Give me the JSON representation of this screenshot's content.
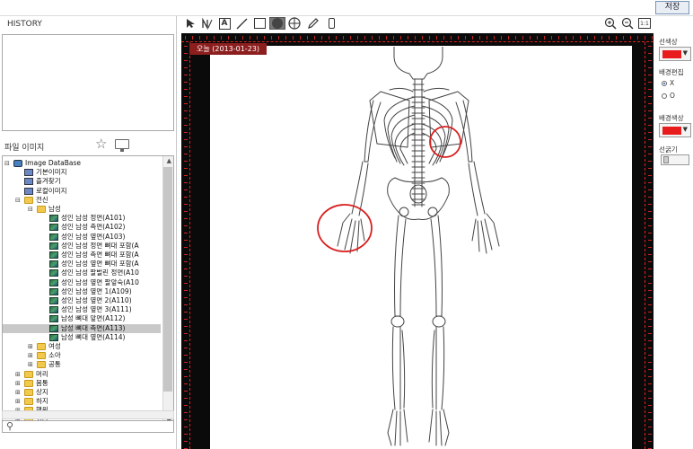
{
  "toolbar": {
    "save_label": "저장",
    "zoom_reset_label": "1:1",
    "tools": [
      "pointer-icon",
      "line-number-icon",
      "text-icon",
      "line-icon",
      "rectangle-icon",
      "ellipse-icon",
      "grid-circle-icon",
      "pen-icon",
      "eraser-icon"
    ],
    "view_tools": [
      "zoom-in-icon",
      "zoom-out-icon",
      "zoom-reset-icon",
      "fit-icon",
      "settings-icon"
    ]
  },
  "left_panel": {
    "history_label": "HISTORY",
    "file_label": "파일 이미지",
    "tree": [
      {
        "level": 0,
        "toggle": "⊟",
        "icon": "db",
        "label": "Image DataBase"
      },
      {
        "level": 1,
        "toggle": "",
        "icon": "util",
        "label": "기본이미지"
      },
      {
        "level": 1,
        "toggle": "",
        "icon": "util",
        "label": "즐겨찾기"
      },
      {
        "level": 1,
        "toggle": "",
        "icon": "util",
        "label": "로컬이미지"
      },
      {
        "level": 1,
        "toggle": "⊟",
        "icon": "folder",
        "label": "전신"
      },
      {
        "level": 2,
        "toggle": "⊟",
        "icon": "folder",
        "label": "남성"
      },
      {
        "level": 3,
        "toggle": "",
        "icon": "img",
        "label": "성인 남성 정면(A101)"
      },
      {
        "level": 3,
        "toggle": "",
        "icon": "img",
        "label": "성인 남성 측면(A102)"
      },
      {
        "level": 3,
        "toggle": "",
        "icon": "img",
        "label": "성인 남성 옆면(A103)"
      },
      {
        "level": 3,
        "toggle": "",
        "icon": "img",
        "label": "성인 남성 정면 뼈대 포함(A"
      },
      {
        "level": 3,
        "toggle": "",
        "icon": "img",
        "label": "성인 남성 측면 뼈대 포함(A"
      },
      {
        "level": 3,
        "toggle": "",
        "icon": "img",
        "label": "성인 남성 옆면 뼈대 포함(A"
      },
      {
        "level": 3,
        "toggle": "",
        "icon": "img",
        "label": "성인 남성 팔벌린 정면(A10"
      },
      {
        "level": 3,
        "toggle": "",
        "icon": "img",
        "label": "성인 남성 옆면 팔앞숙(A10"
      },
      {
        "level": 3,
        "toggle": "",
        "icon": "img",
        "label": "성인 남성 옆면 1(A109)"
      },
      {
        "level": 3,
        "toggle": "",
        "icon": "img",
        "label": "성인 남성 옆면 2(A110)"
      },
      {
        "level": 3,
        "toggle": "",
        "icon": "img",
        "label": "성인 남성 옆면 3(A111)"
      },
      {
        "level": 3,
        "toggle": "",
        "icon": "img",
        "label": "남성 뼈대 앞면(A112)"
      },
      {
        "level": 3,
        "toggle": "",
        "icon": "img",
        "label": "남성 뼈대 측면(A113)",
        "selected": true
      },
      {
        "level": 3,
        "toggle": "",
        "icon": "img",
        "label": "남성 뼈대 옆면(A114)"
      },
      {
        "level": 2,
        "toggle": "⊞",
        "icon": "folder",
        "label": "여성"
      },
      {
        "level": 2,
        "toggle": "⊞",
        "icon": "folder",
        "label": "소아"
      },
      {
        "level": 2,
        "toggle": "⊞",
        "icon": "folder",
        "label": "공통"
      },
      {
        "level": 1,
        "toggle": "⊞",
        "icon": "folder",
        "label": "머리"
      },
      {
        "level": 1,
        "toggle": "⊞",
        "icon": "folder",
        "label": "몸통"
      },
      {
        "level": 1,
        "toggle": "⊞",
        "icon": "folder",
        "label": "상지"
      },
      {
        "level": 1,
        "toggle": "⊞",
        "icon": "folder",
        "label": "하지"
      },
      {
        "level": 1,
        "toggle": "⊞",
        "icon": "folder",
        "label": "행위"
      },
      {
        "level": 1,
        "toggle": "⊞",
        "icon": "folder",
        "label": "기타"
      }
    ]
  },
  "canvas": {
    "date_label": "오늘 (2013-01-23)",
    "annotation_color": "#d81e1e"
  },
  "right_panel": {
    "line_color_label": "선색상",
    "bg_edit_label": "배경편집",
    "radio_x_label": "X",
    "radio_o_label": "O",
    "bg_color_label": "배경색상",
    "line_width_label": "선굵기",
    "swatch_color": "#e81c1c"
  }
}
